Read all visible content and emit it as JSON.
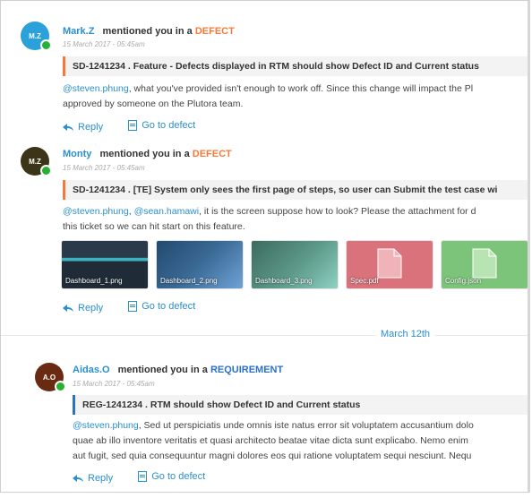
{
  "notifications": [
    {
      "avatar_initials": "M.Z",
      "avatar_color": "#2aa1d8",
      "author": "Mark.Z",
      "mention_text": "mentioned you in a",
      "entity_type": "DEFECT",
      "timestamp": "15 March 2017 - 05:45am",
      "ticket_title": "SD-1241234 . Feature - Defects displayed in RTM should show Defect ID and Current status",
      "body_mention": "@steven.phung",
      "body_line1": ", what you've provided isn't enough to work off. Since this change will impact the Pl",
      "body_line2": "approved by someone on the Plutora team.",
      "reply_label": "Reply",
      "goto_label": "Go to defect"
    },
    {
      "avatar_initials": "M.Z",
      "avatar_color": "#3b3418",
      "author": "Monty",
      "mention_text": "mentioned you in a",
      "entity_type": "DEFECT",
      "timestamp": "15 March 2017 - 05:45am",
      "ticket_title": "SD-1241234 . [TE] System only sees the first page of steps, so user can Submit the test case wi",
      "body_mention_1": "@steven.phung",
      "body_sep": ", ",
      "body_mention_2": "@sean.hamawi",
      "body_line1": ", it is the screen suppose how to look? Please the attachment for d",
      "body_line2": "this ticket so we can hit start on this feature.",
      "attachments": [
        {
          "name": "Dashboard_1.png",
          "color": "#2a3a4a",
          "accent": "#3fb0c0"
        },
        {
          "name": "Dashboard_2.png",
          "color": "#23496e",
          "accent": "#6fa3d6"
        },
        {
          "name": "Dashboard_3.png",
          "color": "#3c6b5e",
          "accent": "#8ed1c4"
        },
        {
          "name": "Spec.pdf",
          "color": "#d9727b",
          "accent": "#f0b4b8"
        },
        {
          "name": "Config.json",
          "color": "#7cc47a",
          "accent": "#b8e3b2"
        }
      ],
      "reply_label": "Reply",
      "goto_label": "Go to defect"
    },
    {
      "avatar_initials": "A.O",
      "avatar_color": "#6a2a12",
      "author": "Aidas.O",
      "mention_text": "mentioned you in a",
      "entity_type": "REQUIREMENT",
      "timestamp": "15 March 2017 - 05:45am",
      "ticket_title": "REG-1241234 . RTM should show Defect ID and Current status",
      "body_mention": "@steven.phung",
      "body_line1": ", Sed ut perspiciatis unde omnis iste natus error sit voluptatem accusantium dolo",
      "body_line2": "quae ab illo inventore veritatis et quasi architecto beatae vitae dicta sunt explicabo. Nemo enim",
      "body_line3": "aut fugit, sed quia consequuntur magni dolores eos qui ratione voluptatem sequi nesciunt. Nequ",
      "reply_label": "Reply",
      "goto_label": "Go to defect"
    }
  ],
  "date_separator": "March 12th"
}
